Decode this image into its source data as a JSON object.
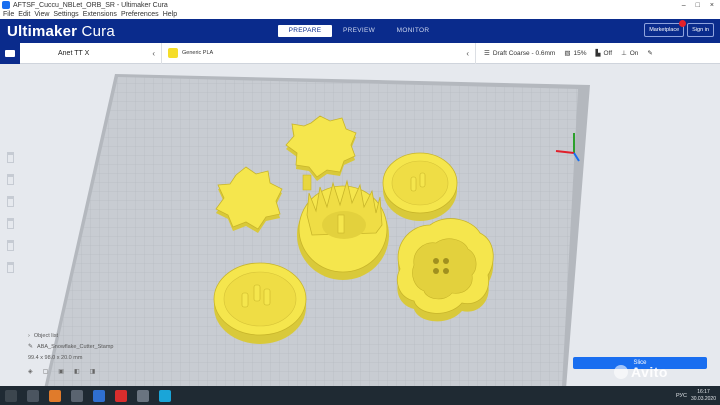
{
  "window": {
    "title": "AFTSF_Cuccu_NBLet_ORB_SR - Ultimaker Cura",
    "controls": [
      "–",
      "□",
      "×"
    ]
  },
  "menu": [
    "File",
    "Edit",
    "View",
    "Settings",
    "Extensions",
    "Preferences",
    "Help"
  ],
  "header": {
    "brand_bold": "Ultimaker",
    "brand_rest": "Cura",
    "stages": [
      "PREPARE",
      "PREVIEW",
      "MONITOR"
    ],
    "active_stage": "PREPARE",
    "marketplace_label": "Marketplace",
    "signin_label": "Sign in"
  },
  "toolbar": {
    "printer": "Anet TT X",
    "material": "Generic PLA",
    "profile": "Draft Coarse - 0.6mm",
    "infill": "15%",
    "support": "Off",
    "adhesion": "On"
  },
  "objects": {
    "list_label": "Object list",
    "object_name": "ABA_Snowflake_Cutter_Stamp",
    "dimensions": "99.4 x 98.0 x 20.0 mm"
  },
  "slice": {
    "button_label": "Slice"
  },
  "watermark": "Avito",
  "taskbar": {
    "lang": "РУС",
    "time": "16:17",
    "date": "30.03.2020"
  },
  "colors": {
    "header_bg": "#0a2b8c",
    "accent": "#196ef0",
    "model_fill": "#f5e64d",
    "build_plate": "#c7cbd1"
  }
}
